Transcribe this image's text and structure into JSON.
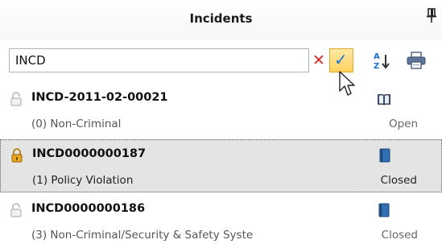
{
  "panel": {
    "title": "Incidents"
  },
  "search": {
    "value": "INCD",
    "placeholder": ""
  },
  "toolbar": {
    "clear_icon": "close-icon",
    "apply_icon": "checkmark-icon",
    "sort_icon": "sort-az-icon",
    "print_icon": "printer-icon"
  },
  "incidents": [
    {
      "id": "INCD-2011-02-00021",
      "category": "(0) Non-Criminal",
      "status": "Open",
      "status_icon": "open-book-icon",
      "lock_state": "unlocked"
    },
    {
      "id": "INCD0000000187",
      "category": "(1) Policy Violation",
      "status": "Closed",
      "status_icon": "closed-book-icon",
      "lock_state": "locked"
    },
    {
      "id": "INCD0000000186",
      "category": "(3) Non-Criminal/Security & Safety Syste",
      "status": "Closed",
      "status_icon": "closed-book-icon",
      "lock_state": "unlocked"
    }
  ],
  "colors": {
    "accent": "#1f6fd1",
    "apply_button": "#ffd35d",
    "clear": "#e02a2a",
    "selected_row": "#e4e4e4",
    "lock_gold": "#d99a1a"
  }
}
